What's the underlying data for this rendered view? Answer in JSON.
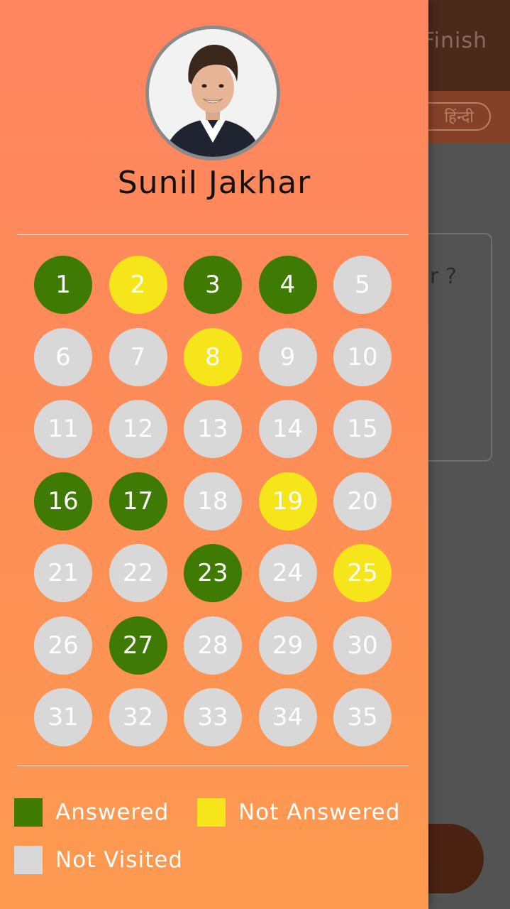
{
  "background": {
    "finish_label": "Finish",
    "language_label": "हिंन्दी",
    "question_fragment": "r ?"
  },
  "drawer": {
    "user_name": "Sunil Jakhar",
    "questions": [
      {
        "number": "1",
        "status": "answered"
      },
      {
        "number": "2",
        "status": "not-answered"
      },
      {
        "number": "3",
        "status": "answered"
      },
      {
        "number": "4",
        "status": "answered"
      },
      {
        "number": "5",
        "status": "not-visited"
      },
      {
        "number": "6",
        "status": "not-visited"
      },
      {
        "number": "7",
        "status": "not-visited"
      },
      {
        "number": "8",
        "status": "not-answered"
      },
      {
        "number": "9",
        "status": "not-visited"
      },
      {
        "number": "10",
        "status": "not-visited"
      },
      {
        "number": "11",
        "status": "not-visited"
      },
      {
        "number": "12",
        "status": "not-visited"
      },
      {
        "number": "13",
        "status": "not-visited"
      },
      {
        "number": "14",
        "status": "not-visited"
      },
      {
        "number": "15",
        "status": "not-visited"
      },
      {
        "number": "16",
        "status": "answered"
      },
      {
        "number": "17",
        "status": "answered"
      },
      {
        "number": "18",
        "status": "not-visited"
      },
      {
        "number": "19",
        "status": "not-answered"
      },
      {
        "number": "20",
        "status": "not-visited"
      },
      {
        "number": "21",
        "status": "not-visited"
      },
      {
        "number": "22",
        "status": "not-visited"
      },
      {
        "number": "23",
        "status": "answered"
      },
      {
        "number": "24",
        "status": "not-visited"
      },
      {
        "number": "25",
        "status": "not-answered"
      },
      {
        "number": "26",
        "status": "not-visited"
      },
      {
        "number": "27",
        "status": "answered"
      },
      {
        "number": "28",
        "status": "not-visited"
      },
      {
        "number": "29",
        "status": "not-visited"
      },
      {
        "number": "30",
        "status": "not-visited"
      },
      {
        "number": "31",
        "status": "not-visited"
      },
      {
        "number": "32",
        "status": "not-visited"
      },
      {
        "number": "33",
        "status": "not-visited"
      },
      {
        "number": "34",
        "status": "not-visited"
      },
      {
        "number": "35",
        "status": "not-visited"
      }
    ],
    "legend": {
      "answered": "Answered",
      "not_answered": "Not Answered",
      "not_visited": "Not Visited"
    }
  },
  "colors": {
    "answered": "#3f7b04",
    "not_answered": "#f7e51b",
    "not_visited": "#d8d8d8",
    "drawer_top": "#ff8560",
    "drawer_bottom": "#fd9a50"
  }
}
